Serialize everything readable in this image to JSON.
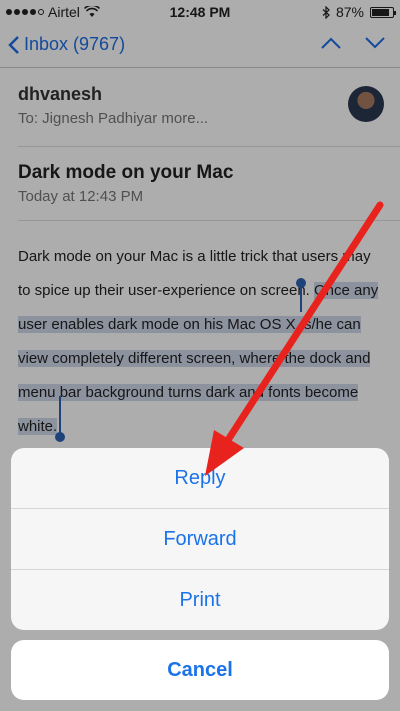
{
  "status_bar": {
    "carrier": "Airtel",
    "time": "12:48 PM",
    "battery": "87%",
    "battery_level": 0.87
  },
  "nav": {
    "back_label": "Inbox (9767)"
  },
  "email": {
    "sender": "dhvanesh",
    "to_line": "To: Jignesh Padhiyar more...",
    "subject": "Dark mode on your Mac",
    "date": "Today at 12:43 PM",
    "body_unselected": "Dark mode on your Mac is a little trick that users may to spice up their user-experience on screen. ",
    "body_selected": "Once any user enables dark mode on his Mac OS X, s/he can view completely different screen, where the dock and menu bar background turns dark and fonts become white."
  },
  "action_sheet": {
    "reply": "Reply",
    "forward": "Forward",
    "print": "Print",
    "cancel": "Cancel"
  },
  "colors": {
    "accent": "#1b73e8",
    "selection": "#cfd9ea",
    "annotation_arrow": "#e8231e"
  }
}
